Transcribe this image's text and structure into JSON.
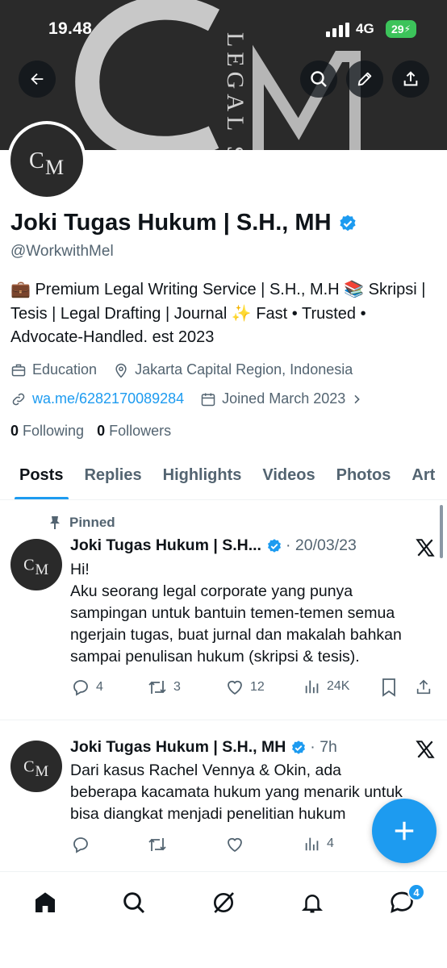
{
  "status_bar": {
    "time": "19.48",
    "network": "4G",
    "battery": "29"
  },
  "header": {
    "back_icon": "arrow-left-icon",
    "search_icon": "search-icon",
    "edit_icon": "pencil-icon",
    "share_icon": "share-icon",
    "banner_text": "LEGAL SOLU"
  },
  "profile": {
    "name": "Joki Tugas Hukum | S.H., MH",
    "handle": "@WorkwithMel",
    "bio": "💼 Premium Legal Writing Service | S.H., M.H 📚 Skripsi | Tesis | Legal Drafting | Journal ✨ Fast • Trusted • Advocate-Handled. est 2023",
    "category": "Education",
    "location": "Jakarta Capital Region, Indonesia",
    "website": "wa.me/6282170089284",
    "joined": "Joined March 2023",
    "following_count": "0",
    "following_label": "Following",
    "followers_count": "0",
    "followers_label": "Followers"
  },
  "tabs": [
    "Posts",
    "Replies",
    "Highlights",
    "Videos",
    "Photos",
    "Art"
  ],
  "tweets": [
    {
      "pinned_label": "Pinned",
      "name": "Joki Tugas Hukum | S.H...",
      "meta": "· 20/03/23",
      "text_lines": [
        "Hi!",
        "Aku seorang legal corporate yang punya",
        "sampingan untuk bantuin temen-temen semua",
        "ngerjain tugas, buat jurnal dan makalah bahkan",
        "sampai penulisan hukum (skripsi & tesis)."
      ],
      "replies": "4",
      "reposts": "3",
      "likes": "12",
      "views": "24K"
    },
    {
      "name": "Joki Tugas Hukum | S.H., MH",
      "meta": "· 7h",
      "text_lines": [
        "Dari kasus Rachel Vennya & Okin, ada",
        "beberapa kacamata hukum yang menarik untuk",
        "bisa diangkat menjadi penelitian hukum"
      ],
      "replies": "",
      "reposts": "",
      "likes": "",
      "views": "4"
    }
  ],
  "bottom_nav": {
    "items": [
      "home-icon",
      "search-icon",
      "grok-icon",
      "notifications-icon",
      "messages-icon"
    ],
    "messages_badge": "4"
  },
  "colors": {
    "accent": "#1d9bf0",
    "text": "#0f1419",
    "secondary": "#536471"
  }
}
